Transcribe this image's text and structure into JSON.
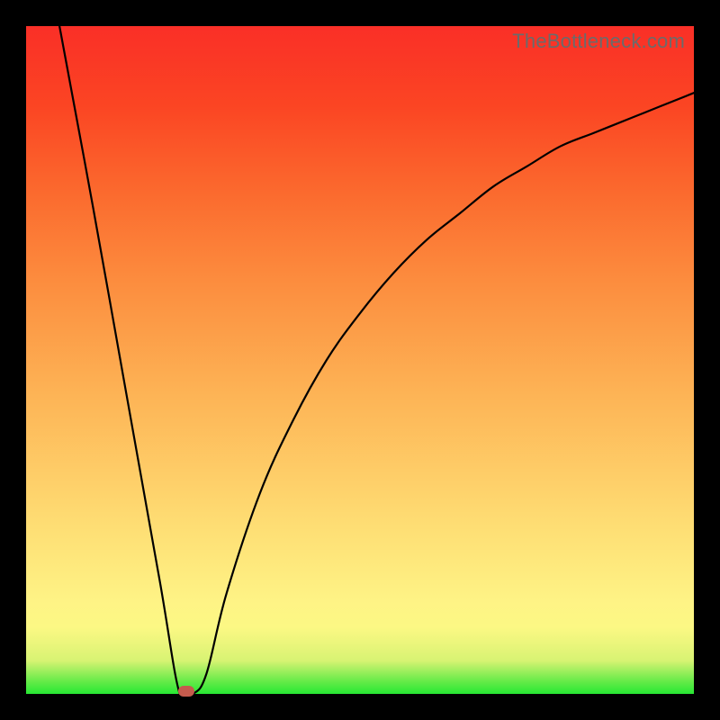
{
  "watermark": "TheBottleneck.com",
  "colors": {
    "frame": "#000000",
    "curve_stroke": "#000000",
    "marker": "#c55b4d",
    "watermark_text": "#6b6b6b"
  },
  "chart_data": {
    "type": "line",
    "title": "",
    "xlabel": "",
    "ylabel": "",
    "xlim": [
      0,
      1
    ],
    "ylim": [
      0,
      100
    ],
    "x": [
      0.05,
      0.1,
      0.15,
      0.2,
      0.23,
      0.25,
      0.27,
      0.3,
      0.35,
      0.4,
      0.45,
      0.5,
      0.55,
      0.6,
      0.65,
      0.7,
      0.75,
      0.8,
      0.85,
      0.9,
      0.95,
      1.0
    ],
    "values": [
      100,
      73,
      45,
      17,
      0,
      0,
      3,
      15,
      30,
      41,
      50,
      57,
      63,
      68,
      72,
      76,
      79,
      82,
      84,
      86,
      88,
      90
    ],
    "minimum": {
      "x": 0.24,
      "value": 0
    },
    "background_gradient_stops": [
      {
        "pos": 0.0,
        "color": "#27e833"
      },
      {
        "pos": 0.02,
        "color": "#6aeb4a"
      },
      {
        "pos": 0.05,
        "color": "#d8f373"
      },
      {
        "pos": 0.1,
        "color": "#fcf884"
      },
      {
        "pos": 0.14,
        "color": "#fef385"
      },
      {
        "pos": 0.25,
        "color": "#fede74"
      },
      {
        "pos": 0.45,
        "color": "#fdb355"
      },
      {
        "pos": 0.62,
        "color": "#fc8c3e"
      },
      {
        "pos": 0.75,
        "color": "#fb6a2e"
      },
      {
        "pos": 0.88,
        "color": "#fb4523"
      },
      {
        "pos": 1.0,
        "color": "#fa2f27"
      }
    ]
  }
}
